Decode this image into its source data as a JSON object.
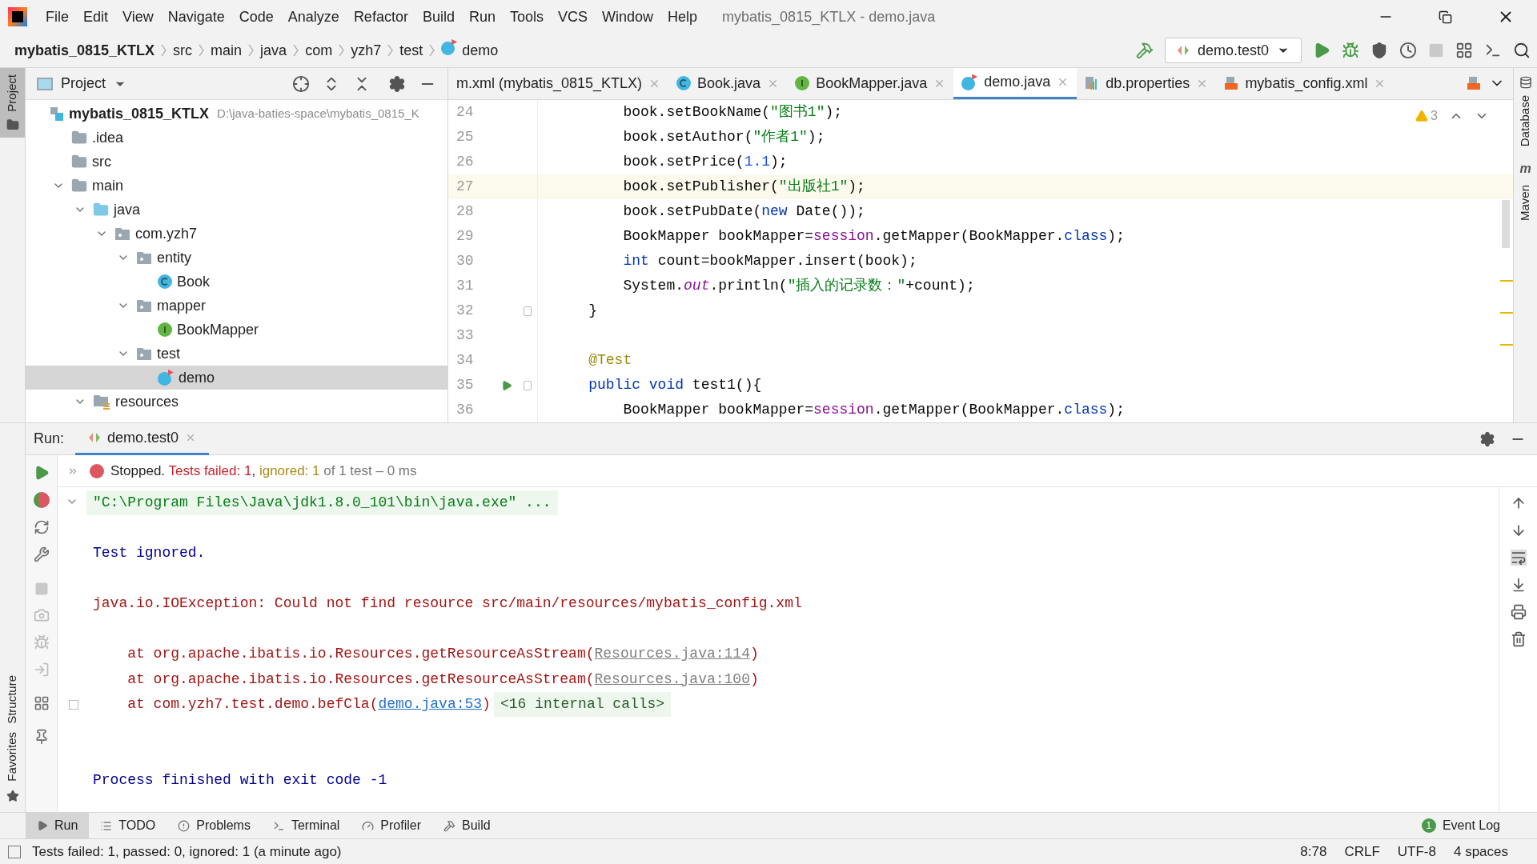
{
  "window": {
    "title": "mybatis_0815_KTLX - demo.java"
  },
  "menu": [
    "File",
    "Edit",
    "View",
    "Navigate",
    "Code",
    "Analyze",
    "Refactor",
    "Build",
    "Run",
    "Tools",
    "VCS",
    "Window",
    "Help"
  ],
  "breadcrumbs": [
    "mybatis_0815_KTLX",
    "src",
    "main",
    "java",
    "com",
    "yzh7",
    "test",
    "demo"
  ],
  "run_config": "demo.test0",
  "left_strip": {
    "top": "Project",
    "bottom": [
      "Structure",
      "Favorites"
    ]
  },
  "right_strip": [
    {
      "label": "Database"
    },
    {
      "label": "Maven",
      "icon": "m"
    }
  ],
  "project_panel": {
    "title": "Project",
    "tree": [
      {
        "label": "mybatis_0815_KTLX",
        "path": "D:\\java-baties-space\\mybatis_0815_K",
        "kind": "module",
        "selected": false,
        "children": [
          {
            "label": ".idea",
            "kind": "folder",
            "selected": false
          },
          {
            "label": "src",
            "kind": "folder",
            "selected": false
          },
          {
            "label": "main",
            "kind": "folder",
            "expanded": true,
            "selected": false,
            "children": [
              {
                "label": "java",
                "kind": "source",
                "expanded": true,
                "selected": false,
                "children": [
                  {
                    "label": "com.yzh7",
                    "kind": "package",
                    "expanded": true,
                    "selected": false,
                    "children": [
                      {
                        "label": "entity",
                        "kind": "package",
                        "expanded": true,
                        "selected": false,
                        "children": [
                          {
                            "label": "Book",
                            "kind": "class",
                            "selected": false
                          }
                        ]
                      },
                      {
                        "label": "mapper",
                        "kind": "package",
                        "expanded": true,
                        "selected": false,
                        "children": [
                          {
                            "label": "BookMapper",
                            "kind": "interface",
                            "selected": false
                          }
                        ]
                      },
                      {
                        "label": "test",
                        "kind": "package",
                        "expanded": true,
                        "selected": false,
                        "children": [
                          {
                            "label": "demo",
                            "kind": "test",
                            "selected": true
                          }
                        ]
                      }
                    ]
                  }
                ]
              },
              {
                "label": "resources",
                "kind": "resources",
                "expanded": true,
                "selected": false
              }
            ]
          }
        ]
      }
    ]
  },
  "editor_tabs": [
    {
      "label": "m.xml (mybatis_0815_KTLX)",
      "kind": "none",
      "selected": false
    },
    {
      "label": "Book.java",
      "kind": "class",
      "selected": false
    },
    {
      "label": "BookMapper.java",
      "kind": "interface",
      "selected": false
    },
    {
      "label": "demo.java",
      "kind": "test",
      "selected": true
    },
    {
      "label": "db.properties",
      "kind": "properties",
      "selected": false
    },
    {
      "label": "mybatis_config.xml",
      "kind": "xml",
      "selected": false
    }
  ],
  "editor": {
    "warnings": "3",
    "lines": [
      {
        "number": "24",
        "current": false,
        "segments": [
          {
            "text": "        book.setBookName(",
            "kind": "plain"
          },
          {
            "text": "\"图书1\"",
            "kind": "string"
          },
          {
            "text": ");",
            "kind": "plain"
          }
        ]
      },
      {
        "number": "25",
        "current": false,
        "segments": [
          {
            "text": "        book.setAuthor(",
            "kind": "plain"
          },
          {
            "text": "\"作者1\"",
            "kind": "string"
          },
          {
            "text": ");",
            "kind": "plain"
          }
        ]
      },
      {
        "number": "26",
        "current": false,
        "segments": [
          {
            "text": "        book.setPrice(",
            "kind": "plain"
          },
          {
            "text": "1.1",
            "kind": "number"
          },
          {
            "text": ");",
            "kind": "plain"
          }
        ]
      },
      {
        "number": "27",
        "current": true,
        "segments": [
          {
            "text": "        book.setPublisher(",
            "kind": "plain"
          },
          {
            "text": "\"出版社1\"",
            "kind": "string"
          },
          {
            "text": ");",
            "kind": "plain"
          }
        ]
      },
      {
        "number": "28",
        "current": false,
        "segments": [
          {
            "text": "        book.setPubDate(",
            "kind": "plain"
          },
          {
            "text": "new",
            "kind": "keyword"
          },
          {
            "text": " Date());",
            "kind": "plain"
          }
        ]
      },
      {
        "number": "29",
        "current": false,
        "segments": [
          {
            "text": "        BookMapper bookMapper=",
            "kind": "plain"
          },
          {
            "text": "session",
            "kind": "field"
          },
          {
            "text": ".getMapper(BookMapper.",
            "kind": "plain"
          },
          {
            "text": "class",
            "kind": "keyword"
          },
          {
            "text": ");",
            "kind": "plain"
          }
        ]
      },
      {
        "number": "30",
        "current": false,
        "segments": [
          {
            "text": "        int",
            "kind": "keyword"
          },
          {
            "text": " count=bookMapper.insert(book);",
            "kind": "plain"
          }
        ]
      },
      {
        "number": "31",
        "current": false,
        "segments": [
          {
            "text": "        System.",
            "kind": "plain"
          },
          {
            "text": "out",
            "kind": "static"
          },
          {
            "text": ".println(",
            "kind": "plain"
          },
          {
            "text": "\"插入的记录数：\"",
            "kind": "string"
          },
          {
            "text": "+count);",
            "kind": "plain"
          }
        ]
      },
      {
        "number": "32",
        "current": false,
        "fold": true,
        "segments": [
          {
            "text": "    }",
            "kind": "plain"
          }
        ]
      },
      {
        "number": "33",
        "current": false
      },
      {
        "number": "34",
        "current": false,
        "segments": [
          {
            "text": "    @Test",
            "kind": "annotation"
          }
        ]
      },
      {
        "number": "35",
        "current": false,
        "fold": true,
        "run": true,
        "segments": [
          {
            "text": "    public void",
            "kind": "keyword"
          },
          {
            "text": " test1(){",
            "kind": "plain"
          }
        ]
      },
      {
        "number": "36",
        "current": false,
        "segments": [
          {
            "text": "        BookMapper bookMapper=",
            "kind": "plain"
          },
          {
            "text": "session",
            "kind": "field"
          },
          {
            "text": ".getMapper(BookMapper.",
            "kind": "plain"
          },
          {
            "text": "class",
            "kind": "keyword"
          },
          {
            "text": ");",
            "kind": "plain"
          }
        ]
      }
    ]
  },
  "run_panel": {
    "label": "Run:",
    "tab": "demo.test0",
    "status": [
      {
        "text": "Stopped.",
        "kind": "plain"
      },
      {
        "text": "Tests failed: 1",
        "kind": "failed"
      },
      {
        "text": ",",
        "kind": "plain"
      },
      {
        "text": "ignored: 1",
        "kind": "ignored"
      },
      {
        "text": "of 1 test – 0 ms",
        "kind": "muted"
      }
    ],
    "console": [
      {
        "kind": "command",
        "text": "\"C:\\Program Files\\Java\\jdk1.8.0_101\\bin\\java.exe\" ..."
      },
      {
        "kind": "blank"
      },
      {
        "kind": "info",
        "text": "Test ignored."
      },
      {
        "kind": "blank"
      },
      {
        "kind": "error",
        "text": "java.io.IOException: Could not find resource src/main/resources/mybatis_config.xml"
      },
      {
        "kind": "blank"
      },
      {
        "kind": "trace",
        "text": "    at org.apache.ibatis.io.Resources.getResourceAsStream(",
        "link": "Resources.java:114",
        "in_project": false,
        "suffix": ")"
      },
      {
        "kind": "trace",
        "text": "    at org.apache.ibatis.io.Resources.getResourceAsStream(",
        "link": "Resources.java:100",
        "in_project": false,
        "suffix": ")"
      },
      {
        "kind": "trace",
        "text": "    at com.yzh7.test.demo.befCla(",
        "link": "demo.java:53",
        "in_project": true,
        "suffix": ")",
        "folded": "<16 internal calls>"
      },
      {
        "kind": "blank"
      },
      {
        "kind": "blank"
      },
      {
        "kind": "info",
        "text": "Process finished with exit code -1"
      }
    ]
  },
  "tool_tabs": [
    {
      "label": "Run",
      "kind": "run",
      "selected": true
    },
    {
      "label": "TODO",
      "kind": "todo",
      "selected": false
    },
    {
      "label": "Problems",
      "kind": "problems",
      "selected": false
    },
    {
      "label": "Terminal",
      "kind": "terminal",
      "selected": false
    },
    {
      "label": "Profiler",
      "kind": "profiler",
      "selected": false
    },
    {
      "label": "Build",
      "kind": "build",
      "selected": false
    }
  ],
  "event_log": {
    "label": "Event Log",
    "count": "1"
  },
  "status_bar": {
    "message": "Tests failed: 1, passed: 0, ignored: 1 (a minute ago)",
    "position": "8:78",
    "line_ending": "CRLF",
    "encoding": "UTF-8",
    "indent": "4 spaces"
  }
}
